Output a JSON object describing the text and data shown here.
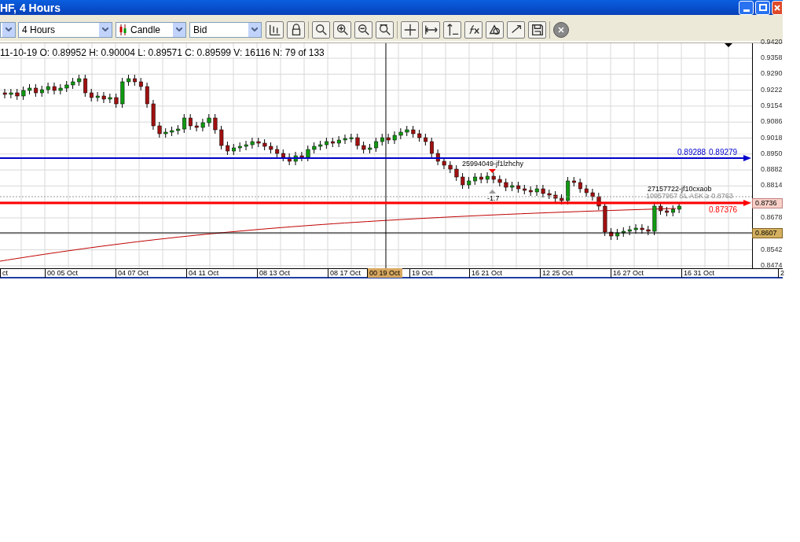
{
  "window": {
    "title": "HF, 4 Hours"
  },
  "toolbar": {
    "dropdowns": [
      {
        "value": "4 Hours"
      },
      {
        "value": "Candle"
      },
      {
        "value": "Bid"
      }
    ]
  },
  "chart": {
    "info": "11-10-19  O: 0.89952  H: 0.90004  L: 0.89571  C: 0.89599  V: 16116  N: 79 of 133",
    "y_axis_labels": [
      "0.9420",
      "0.9358",
      "0.9290",
      "0.9222",
      "0.9154",
      "0.9086",
      "0.9018",
      "0.8950",
      "0.8882",
      "0.8814",
      "0.8678",
      "0.8542",
      "0.8474"
    ],
    "x_axis_labels": [
      {
        "text": "ct",
        "selected": false
      },
      {
        "text": "00 05 Oct",
        "selected": false
      },
      {
        "text": "04 07 Oct",
        "selected": false
      },
      {
        "text": "04 11 Oct",
        "selected": false
      },
      {
        "text": "08 13 Oct",
        "selected": false
      },
      {
        "text": "08 17 Oct",
        "selected": false
      },
      {
        "text": "00 19 Oct",
        "selected": true
      },
      {
        "text": "19 Oct",
        "selected": false
      },
      {
        "text": "16 21 Oct",
        "selected": false
      },
      {
        "text": "12 25 Oct",
        "selected": false
      },
      {
        "text": "16 27 Oct",
        "selected": false
      },
      {
        "text": "16 31 Oct",
        "selected": false
      },
      {
        "text": "2",
        "selected": false
      }
    ],
    "price_tags": [
      {
        "text": "0.8736",
        "kind": "order"
      },
      {
        "text": "0.8607",
        "kind": "cursor"
      }
    ],
    "lines": [
      {
        "color": "#0000cc",
        "labels": [
          "0.89288",
          "0.89279"
        ]
      },
      {
        "color": "#ff0000",
        "labels": [
          "0.87376"
        ]
      }
    ],
    "order_labels": [
      "25994049-jf1lzhchy",
      "-1.7",
      "27157722-jf10cxaob",
      "10957957 SL ASK ≥ 0.8763"
    ]
  }
}
